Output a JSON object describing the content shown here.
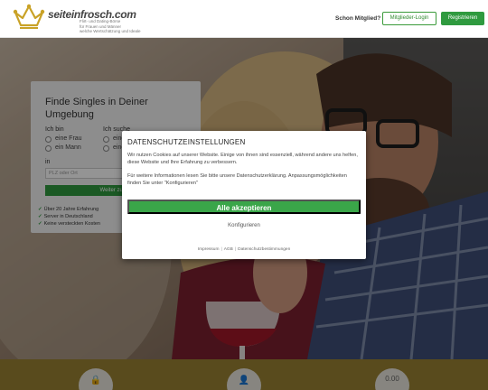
{
  "header": {
    "logo_name": "seiteinfrosch.com",
    "tagline": [
      "Flirt- und Dating-Börse",
      "für Frauen und Männer",
      "welche Wertschätzung und Ideale"
    ],
    "member_question": "Schon Mitglied?",
    "login_label": "Mitglieder-Login",
    "register_label": "Registrieren"
  },
  "search": {
    "title": "Finde Singles in Deiner Umgebung",
    "i_am_label": "Ich bin",
    "i_am_options": [
      "eine Frau",
      "ein Mann"
    ],
    "looking_label": "Ich suche",
    "looking_options": [
      "eine",
      "eine"
    ],
    "in_label": "in",
    "plz_placeholder": "PLZ oder Ort",
    "submit_label": "Weiter zu Schritt",
    "checks": [
      "Über 20 Jahre Erfahrung",
      "Server in Deutschland",
      "Keine versteckten Kosten"
    ]
  },
  "features": {
    "price_label": "0.00"
  },
  "consent": {
    "title": "DATENSCHUTZEINSTELLUNGEN",
    "text1": "Wir nutzen Cookies auf unserer Website. Einige von ihnen sind essenziell, während andere uns helfen, diese Website und Ihre Erfahrung zu verbessern.",
    "text2": "Für weitere Informationen lesen Sie bitte unsere Datenschutzerklärung. Anpassungsmöglichkeiten finden Sie unter \"Konfigurieren\"",
    "accept_label": "Alle akzeptieren",
    "configure_label": "Konfigurieren",
    "links": [
      "Impressum",
      "AGB",
      "Datenschutzbestimmungen"
    ]
  },
  "colors": {
    "accent_green": "#3aa649",
    "brand_gold": "#9a8232"
  }
}
